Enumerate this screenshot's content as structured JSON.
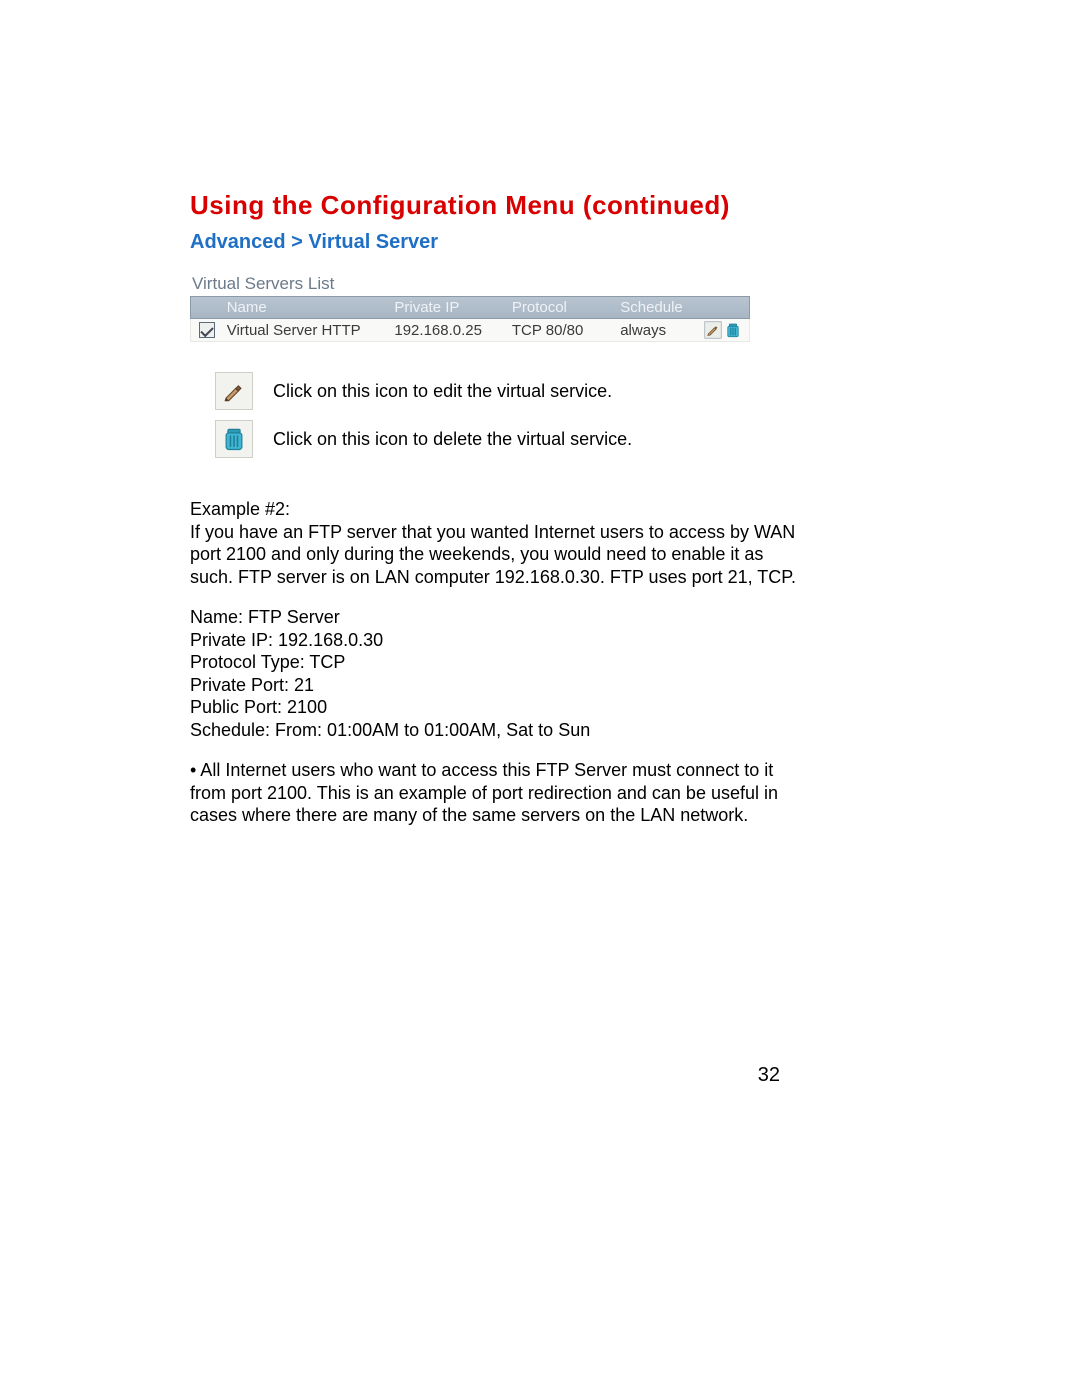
{
  "title": "Using the Configuration Menu (continued)",
  "subtitle": "Advanced > Virtual Server",
  "table": {
    "caption": "Virtual Servers List",
    "headers": {
      "name": "Name",
      "private_ip": "Private IP",
      "protocol": "Protocol",
      "schedule": "Schedule"
    },
    "row": {
      "name": "Virtual Server HTTP",
      "private_ip": "192.168.0.25",
      "protocol": "TCP 80/80",
      "schedule": "always"
    }
  },
  "legend": {
    "edit": "Click on this icon to edit the virtual service.",
    "delete": "Click on this icon to delete the virtual service."
  },
  "example": {
    "label": "Example #2:",
    "para": "If you have an FTP server that you wanted Internet users to access by WAN port 2100 and only during the weekends, you would need to enable it as such. FTP server is on LAN computer 192.168.0.30. FTP uses port 21, TCP.",
    "settings": {
      "name": "Name: FTP Server",
      "private_ip": "Private IP: 192.168.0.30",
      "protocol_type": "Protocol Type: TCP",
      "private_port": "Private Port: 21",
      "public_port": "Public Port: 2100",
      "schedule": "Schedule: From: 01:00AM to 01:00AM, Sat to Sun"
    },
    "note": "• All Internet users who want to access this FTP Server must connect to it from port 2100. This is an example of port redirection and can be useful in cases where there are many of the same servers on the LAN network."
  },
  "page_number": "32"
}
